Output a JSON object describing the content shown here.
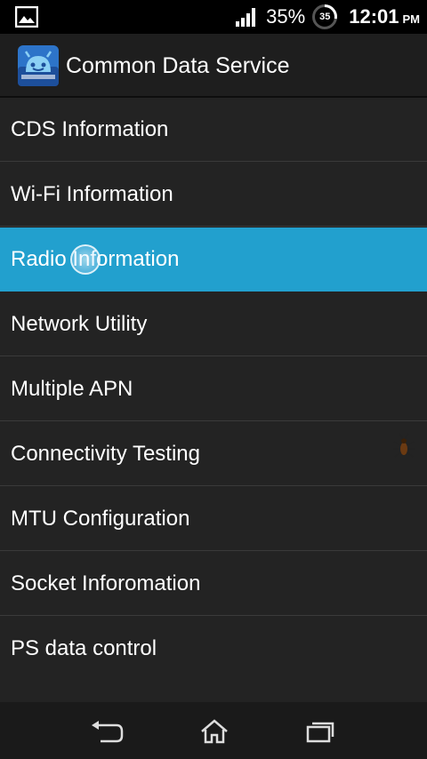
{
  "status_bar": {
    "battery_percent": "35%",
    "battery_ring_value": "35",
    "time": "12:01",
    "ampm": "PM",
    "icons": [
      "gallery-notification-icon",
      "signal-icon",
      "battery-icon"
    ]
  },
  "app_bar": {
    "title": "Common Data Service",
    "icon": "android-app-icon"
  },
  "menu": {
    "items": [
      {
        "label": "CDS Information"
      },
      {
        "label": "Wi-Fi Information"
      },
      {
        "label": "Radio Information",
        "selected": true
      },
      {
        "label": "Network Utility"
      },
      {
        "label": "Multiple APN"
      },
      {
        "label": "Connectivity Testing"
      },
      {
        "label": "MTU Configuration"
      },
      {
        "label": "Socket Inforomation"
      },
      {
        "label": "PS data control"
      }
    ]
  },
  "nav_bar": {
    "buttons": [
      "back-icon",
      "home-icon",
      "recent-apps-icon"
    ]
  },
  "colors": {
    "selected_row": "#22a0ce",
    "list_background": "#232323",
    "divider": "#3a3a3a"
  }
}
